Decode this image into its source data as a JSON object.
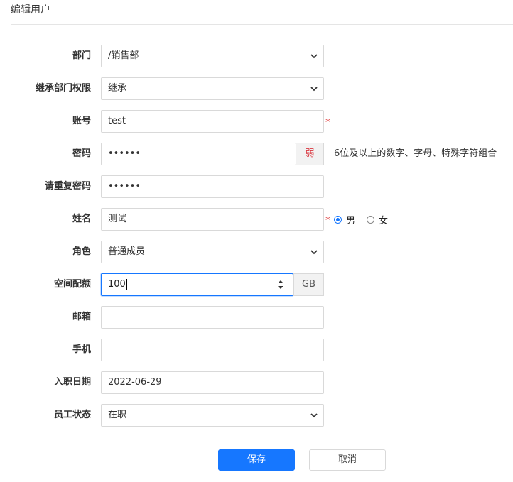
{
  "header": {
    "title": "编辑用户"
  },
  "form": {
    "department": {
      "label": "部门",
      "value": "/销售部"
    },
    "inherit": {
      "label": "继承部门权限",
      "value": "继承"
    },
    "account": {
      "label": "账号",
      "value": "test",
      "required_mark": "*"
    },
    "password": {
      "label": "密码",
      "value": "••••••",
      "strength": "弱",
      "hint": "6位及以上的数字、字母、特殊字符组合"
    },
    "confirm_password": {
      "label": "请重复密码",
      "value": "••••••"
    },
    "name": {
      "label": "姓名",
      "value": "测试",
      "required_mark": "*",
      "gender_options": [
        "男",
        "女"
      ],
      "gender_selected": "男"
    },
    "role": {
      "label": "角色",
      "value": "普通成员"
    },
    "quota": {
      "label": "空间配额",
      "value": "100",
      "unit": "GB"
    },
    "email": {
      "label": "邮箱",
      "value": ""
    },
    "phone": {
      "label": "手机",
      "value": ""
    },
    "hire_date": {
      "label": "入职日期",
      "value": "2022-06-29"
    },
    "status": {
      "label": "员工状态",
      "value": "在职"
    }
  },
  "actions": {
    "save_label": "保存",
    "cancel_label": "取消"
  },
  "colors": {
    "primary": "#1677ff",
    "required": "#e03b3b",
    "weak": "#d9363e"
  }
}
